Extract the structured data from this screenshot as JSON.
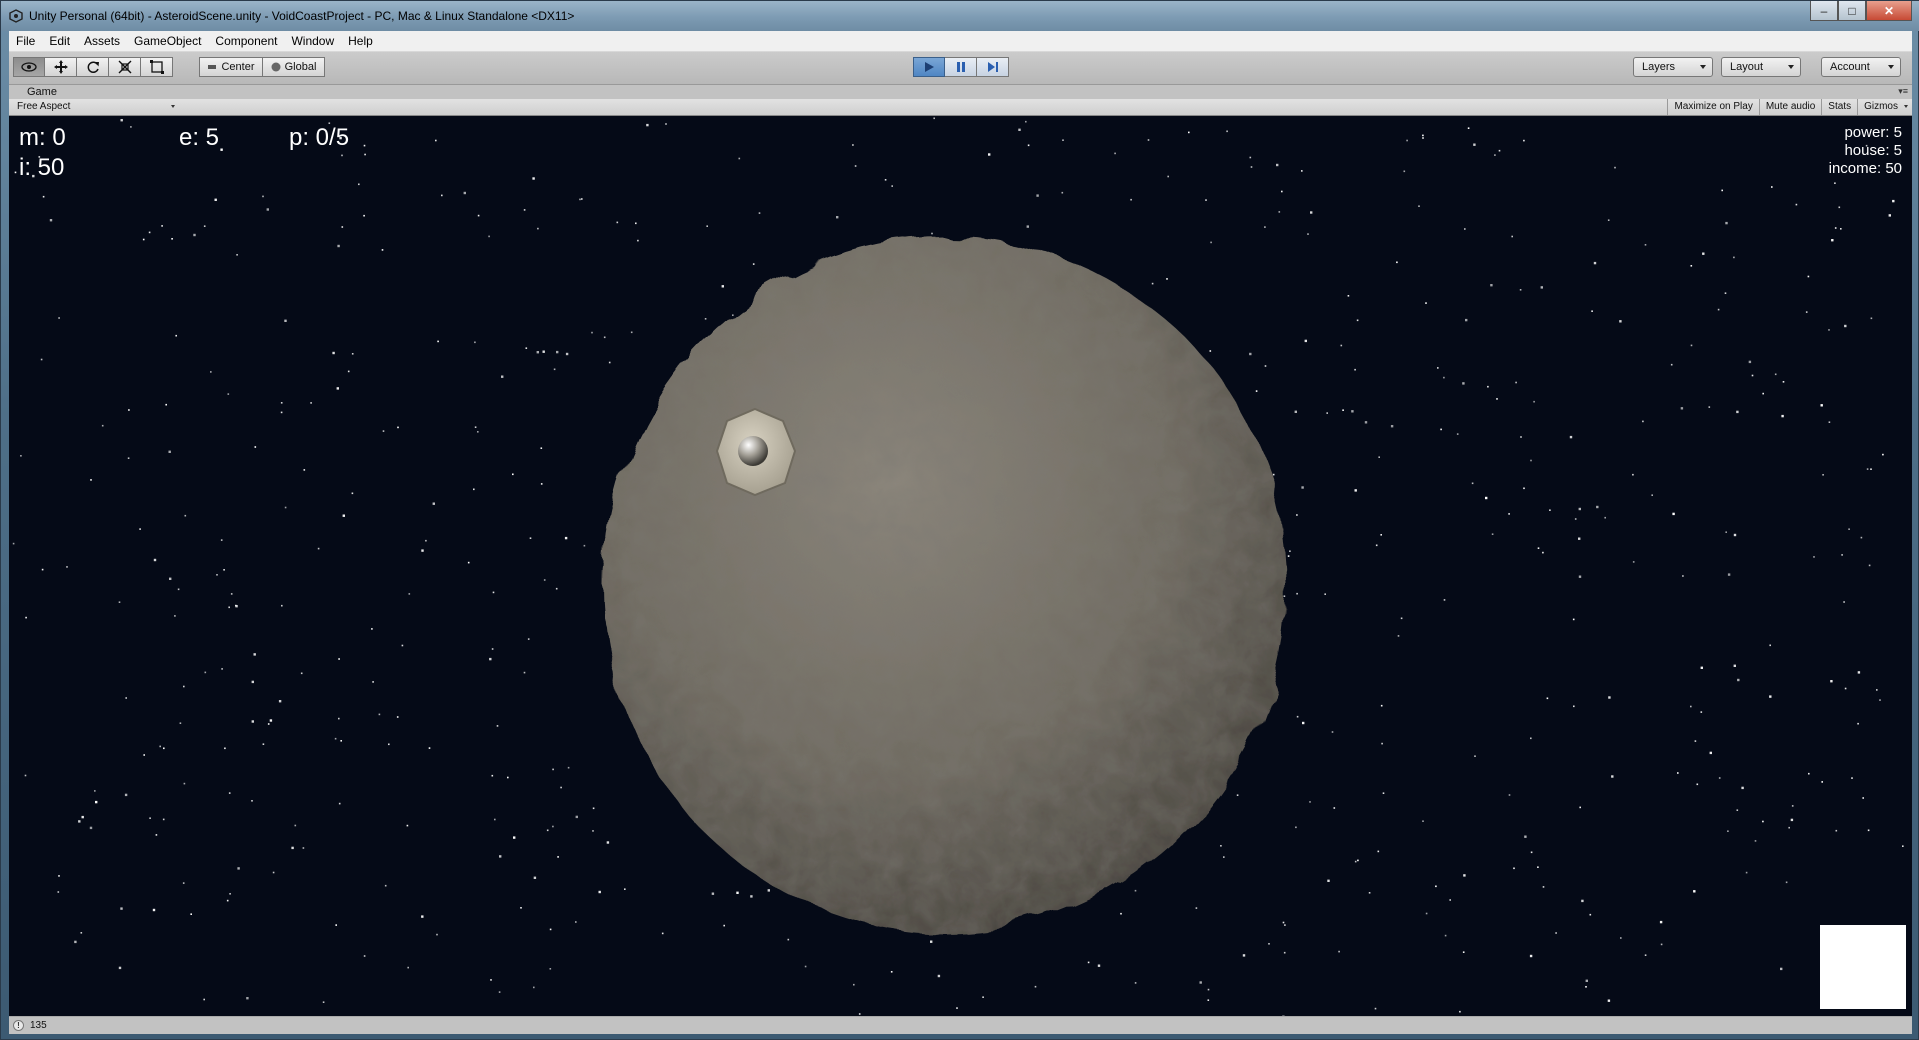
{
  "window": {
    "title": "Unity Personal (64bit) - AsteroidScene.unity - VoidCoastProject - PC, Mac & Linux Standalone <DX11>",
    "controls": {
      "minimize": "–",
      "maximize": "□",
      "close": "✕"
    }
  },
  "menu": [
    "File",
    "Edit",
    "Assets",
    "GameObject",
    "Component",
    "Window",
    "Help"
  ],
  "toolbar": {
    "tools": [
      {
        "name": "hand-tool",
        "glyph": "👁"
      },
      {
        "name": "move-tool",
        "glyph": "✥"
      },
      {
        "name": "rotate-tool",
        "glyph": "↻"
      },
      {
        "name": "scale-tool",
        "glyph": "⤢"
      },
      {
        "name": "rect-tool",
        "glyph": "▣"
      }
    ],
    "pivot_label": "Center",
    "space_label": "Global",
    "layers_label": "Layers",
    "layout_label": "Layout",
    "account_label": "Account"
  },
  "game_panel": {
    "tab_label": "Game",
    "aspect_label": "Free Aspect",
    "buttons": {
      "maximize": "Maximize on Play",
      "mute": "Mute audio",
      "stats": "Stats",
      "gizmos": "Gizmos"
    }
  },
  "hud": {
    "m": "m: 0",
    "e": "e: 5",
    "p": "p: 0/5",
    "i": "i: 50",
    "power": "power: 5",
    "house": "house: 5",
    "income": "income: 50"
  },
  "status": {
    "text": "135"
  },
  "colors": {
    "space": "#050a17",
    "asteroid": "#7a7468",
    "play_accent": "#4f86c4"
  }
}
